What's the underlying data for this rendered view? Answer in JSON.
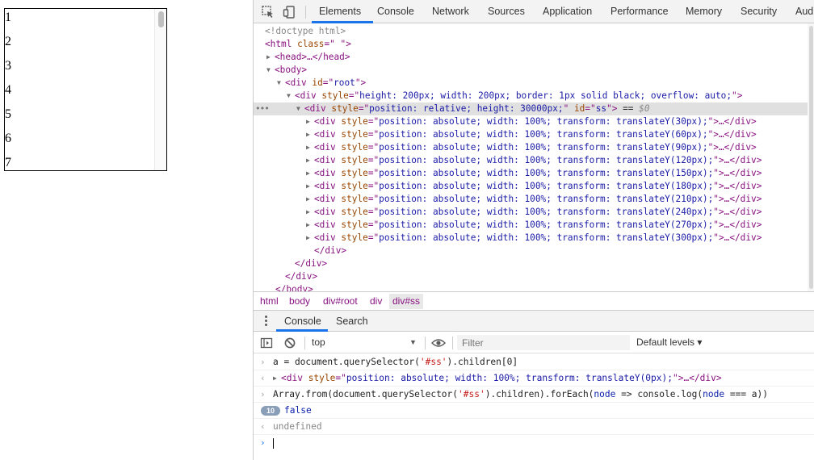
{
  "page": {
    "rows": [
      "1",
      "2",
      "3",
      "4",
      "5",
      "6",
      "7"
    ]
  },
  "devtools": {
    "tabs": [
      "Elements",
      "Console",
      "Network",
      "Sources",
      "Application",
      "Performance",
      "Memory",
      "Security",
      "Audi"
    ],
    "active_tab": "Elements",
    "tree": {
      "doctype": "<!doctype html>",
      "html_open_tag": "<html ",
      "html_attr_name": "class",
      "html_attr_eq": "=\"",
      "html_attr_val": " ",
      "html_close_q": "\">",
      "head": "<head>…</head>",
      "body_open": "<body>",
      "root_div_tag": "<div ",
      "root_div_attr": "id",
      "root_div_eq": "=\"",
      "root_div_val": "root",
      "root_div_end": "\">",
      "outer_div_tag": "<div ",
      "outer_div_attr": "style",
      "outer_div_eq": "=\"",
      "outer_div_val": "height: 200px; width: 200px; border: 1px solid black; overflow: auto;",
      "outer_div_end": "\">",
      "sel_div_tag": "<div ",
      "sel_div_attr": "style",
      "sel_div_eq": "=\"",
      "sel_div_val": "position: relative; height: 30000px;",
      "sel_div_mid": "\" ",
      "sel_div_attr2": "id",
      "sel_div_eq2": "=\"",
      "sel_div_val2": "ss",
      "sel_div_end": "\">",
      "sel_marker": " == ",
      "sel_ref": "$0",
      "child_prefix": "<div ",
      "child_attr": "style",
      "child_eq": "=\"",
      "child_values": [
        "position: absolute; width: 100%; transform: translateY(30px);",
        "position: absolute; width: 100%; transform: translateY(60px);",
        "position: absolute; width: 100%; transform: translateY(90px);",
        "position: absolute; width: 100%; transform: translateY(120px);",
        "position: absolute; width: 100%; transform: translateY(150px);",
        "position: absolute; width: 100%; transform: translateY(180px);",
        "position: absolute; width: 100%; transform: translateY(210px);",
        "position: absolute; width: 100%; transform: translateY(240px);",
        "position: absolute; width: 100%; transform: translateY(270px);",
        "position: absolute; width: 100%; transform: translateY(300px);"
      ],
      "child_suffix": "\">…</div>",
      "close_div": "</div>",
      "close_body": "</body>"
    },
    "breadcrumbs": [
      "html",
      "body",
      "div#root",
      "div",
      "div#ss"
    ],
    "drawer_tabs": [
      "Console",
      "Search"
    ],
    "console_toolbar": {
      "context": "top",
      "filter_placeholder": "Filter",
      "levels": "Default levels ▾"
    },
    "console": {
      "line1_prefix": "a = document.querySelector(",
      "line1_str": "'#ss'",
      "line1_suffix": ").children[0]",
      "line2_tag": "<div ",
      "line2_attr": "style",
      "line2_eq": "=\"",
      "line2_val": "position: absolute; width: 100%; transform: translateY(0px);",
      "line2_end": "\">…</div>",
      "line3_a": "Array.from(document.querySelector(",
      "line3_str": "'#ss'",
      "line3_b": ").children).forEach(",
      "line3_kw": "node",
      "line3_c": " => console.log(",
      "line3_kw2": "node",
      "line3_d": " === a))",
      "badge_count": "10",
      "line4": "false",
      "line5": "undefined"
    }
  }
}
